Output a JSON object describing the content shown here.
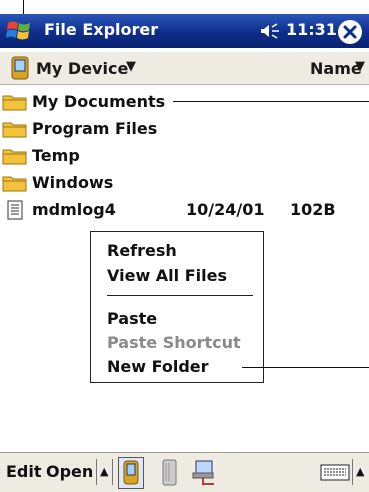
{
  "title_bar": {
    "app_title": "File Explorer",
    "time": "11:31"
  },
  "address_bar": {
    "location": "My Device",
    "sort_by": "Name"
  },
  "file_list": [
    {
      "name": "My Documents",
      "type": "folder",
      "date": "",
      "size": ""
    },
    {
      "name": "Program Files",
      "type": "folder",
      "date": "",
      "size": ""
    },
    {
      "name": "Temp",
      "type": "folder",
      "date": "",
      "size": ""
    },
    {
      "name": "Windows",
      "type": "folder",
      "date": "",
      "size": ""
    },
    {
      "name": "mdmlog4",
      "type": "file",
      "date": "10/24/01",
      "size": "102B"
    }
  ],
  "context_menu": {
    "refresh": "Refresh",
    "view_all_files": "View All Files",
    "paste": "Paste",
    "paste_shortcut": "Paste Shortcut",
    "new_folder": "New Folder"
  },
  "bottom_bar": {
    "edit": "Edit",
    "open": "Open"
  },
  "colors": {
    "title_bar": "#0d2d8a",
    "folder": "#f2c33a",
    "bar_background": "#eeebe2"
  }
}
